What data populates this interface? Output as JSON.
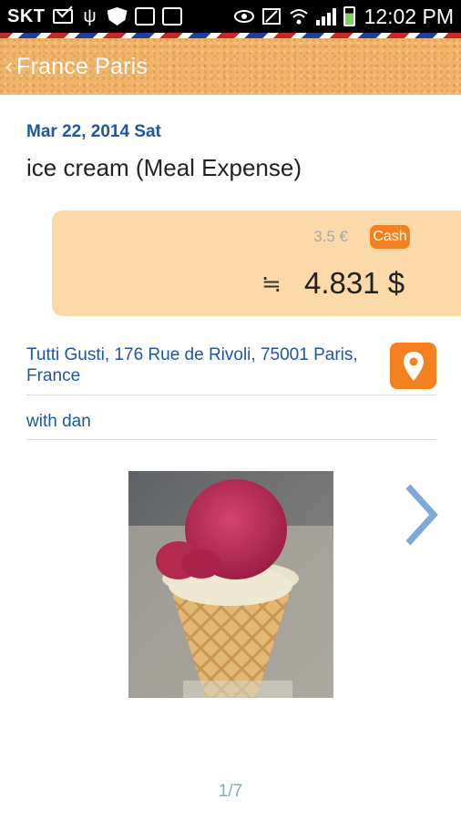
{
  "status_bar": {
    "carrier": "SKT",
    "clock": "12:02 PM",
    "icons": [
      "mail-icon",
      "usb-icon",
      "shield-icon",
      "download-icon",
      "clipboard-icon",
      "eye-icon",
      "nfc-icon",
      "wifi-icon",
      "signal-icon",
      "battery-icon"
    ]
  },
  "header": {
    "back_glyph": "‹",
    "title": "France Paris"
  },
  "expense": {
    "date": "Mar 22, 2014 Sat",
    "title": "ice cream (Meal Expense)",
    "original_amount": "3.5 €",
    "payment_method": "Cash",
    "approx_symbol": "≒",
    "converted_amount": "4.831 $",
    "location": "Tutti Gusti, 176 Rue de Rivoli, 75001 Paris, France",
    "companion": "with dan"
  },
  "gallery": {
    "pager": "1/7",
    "photo_subject": "ice cream cone"
  },
  "colors": {
    "accent_blue": "#1f55a8",
    "orange": "#f5801f",
    "card_bg": "#fbd9a8",
    "header_cork": "#f1b56a"
  }
}
